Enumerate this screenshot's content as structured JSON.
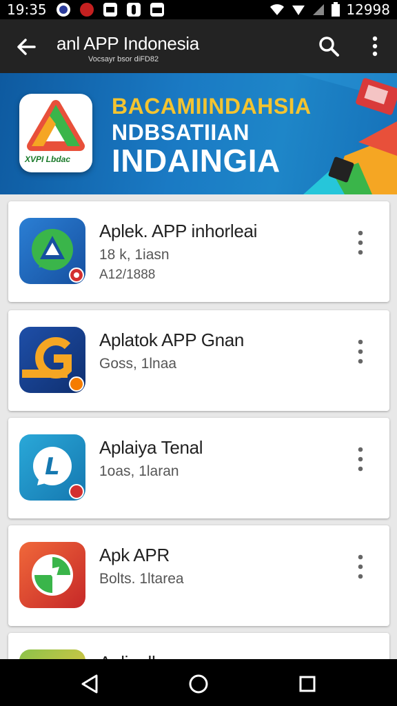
{
  "status_bar": {
    "time": "19:35",
    "battery_text": "12998",
    "icons": [
      "notification-icon-1",
      "notification-icon-2",
      "notification-icon-3",
      "notification-icon-4",
      "notification-icon-5",
      "wifi-icon",
      "signal-icon",
      "signal-icon-2",
      "battery-icon"
    ]
  },
  "app_bar": {
    "title": "anl APP Indonesia",
    "subtitle": "Vocsayr bsor diFD82",
    "icons": [
      "back-arrow-icon",
      "search-icon",
      "more-vertical-icon"
    ]
  },
  "banner": {
    "line1": "BACAMIINDAHSIA",
    "line2": "NDBSATIIAN",
    "line3": "INDAINGIA",
    "logo_text": "XVPI Lbdac"
  },
  "apps": [
    {
      "name": "Aplek. APP inhorleai",
      "meta": "18 k, 1iasn",
      "meta2": "A12/1888",
      "icon": "app-icon-1"
    },
    {
      "name": "Aplatok APP Gnan",
      "meta": "Goss, 1lnaa",
      "meta2": "",
      "icon": "app-icon-2"
    },
    {
      "name": "Aplaiya Tenal",
      "meta": "1oas, 1laran",
      "meta2": "",
      "icon": "app-icon-3"
    },
    {
      "name": "Apk APR",
      "meta": "Bolts. 1ltarea",
      "meta2": "",
      "icon": "app-icon-4"
    },
    {
      "name": "Aplinalhaar",
      "meta": "",
      "meta2": "",
      "icon": "app-icon-5"
    }
  ],
  "nav_bar": {
    "icons": [
      "back-triangle-icon",
      "home-circle-icon",
      "recents-square-icon"
    ]
  },
  "colors": {
    "status_bar": "#000000",
    "app_bar": "#232323",
    "banner": "#1a7ac4",
    "banner_accent": "#f4c430",
    "background": "#e8e8e8"
  }
}
